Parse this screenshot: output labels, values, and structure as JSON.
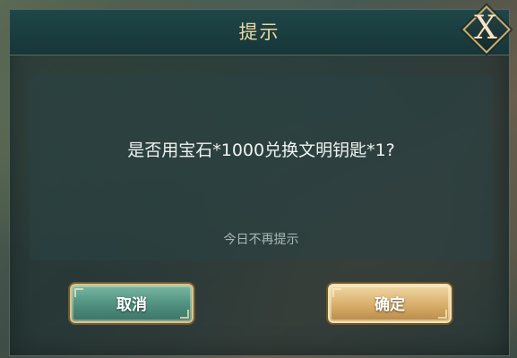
{
  "dialog": {
    "title": "提示",
    "close_label": "X",
    "message": "是否用宝石*1000兑换文明钥匙*1?",
    "no_remind_label": "今日不再提示",
    "cancel_label": "取消",
    "confirm_label": "确定"
  },
  "icons": {
    "close": "close-icon"
  },
  "colors": {
    "title_text": "#ecd7a0",
    "cancel_button": "#4f8f7e",
    "confirm_button": "#d8ae6b"
  }
}
